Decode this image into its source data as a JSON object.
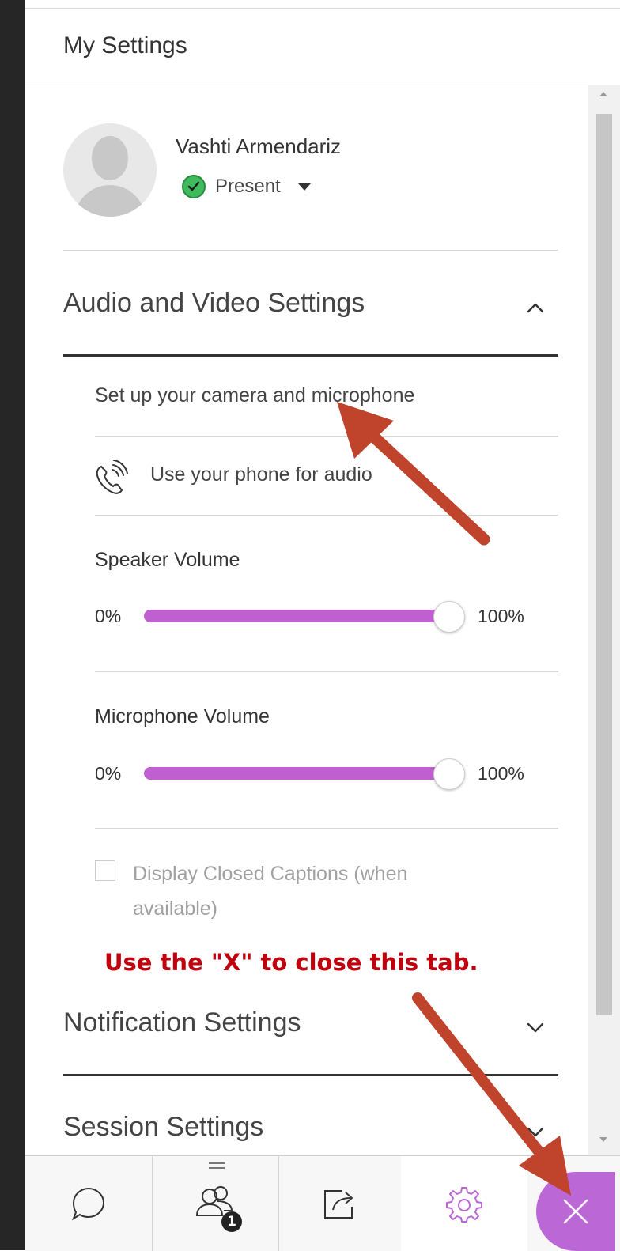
{
  "panel": {
    "title": "My Settings"
  },
  "user": {
    "name": "Vashti Armendariz",
    "status": "Present"
  },
  "audio_video": {
    "title": "Audio and Video Settings",
    "camera_setup": "Set up your camera and microphone",
    "phone_audio": "Use your phone for audio",
    "speaker": {
      "label": "Speaker Volume",
      "min": "0%",
      "max": "100%",
      "level_percent": 100
    },
    "microphone": {
      "label": "Microphone Volume",
      "min": "0%",
      "max": "100%",
      "level_percent": 100
    },
    "captions": {
      "label": "Display Closed Captions (when available)",
      "checked": false,
      "enabled": false
    }
  },
  "annotation": {
    "text": "Use the \"X\" to close this tab."
  },
  "sections": {
    "notifications": "Notification Settings",
    "session": "Session Settings"
  },
  "bottom_bar": {
    "attendees_badge": "1",
    "items": [
      "chat-icon",
      "attendees-icon",
      "share-content-icon",
      "settings-icon",
      "close-icon"
    ],
    "active_item": "settings-icon"
  },
  "colors": {
    "accent": "#bb67d6",
    "slider": "#c060d0",
    "status_present": "#3fba5c",
    "annotation_text": "#c0000c",
    "annotation_arrow": "#c0432b"
  }
}
